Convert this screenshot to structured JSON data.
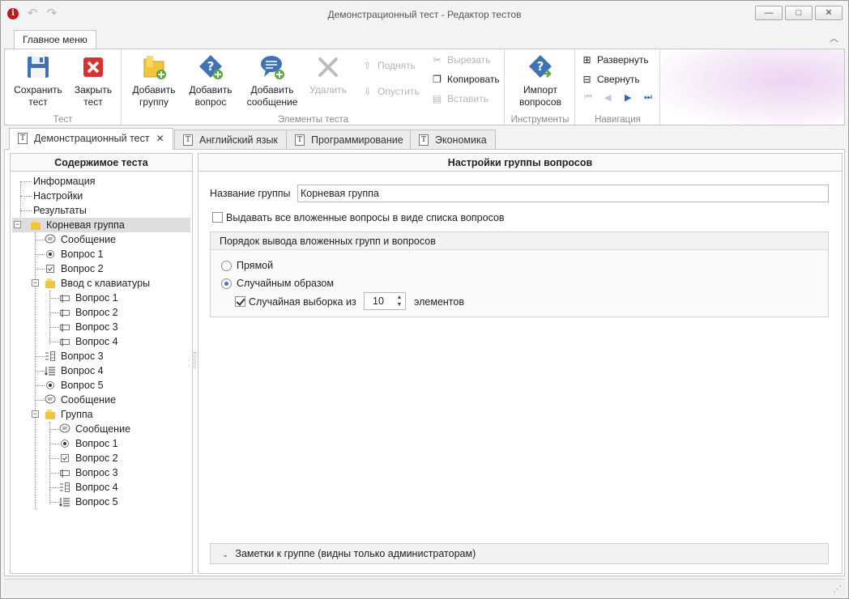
{
  "window": {
    "title": "Демонстрационный тест - Редактор тестов",
    "controls": {
      "minimize": "—",
      "maximize": "□",
      "close": "✕"
    }
  },
  "ribbon": {
    "active_tab": "Главное меню",
    "groups": {
      "test": {
        "label": "Тест",
        "save": "Сохранить\nтест",
        "close": "Закрыть\nтест"
      },
      "elements": {
        "label": "Элементы теста",
        "add_group": "Добавить\nгруппу",
        "add_question": "Добавить\nвопрос",
        "add_message": "Добавить\nсообщение",
        "delete": "Удалить",
        "move_up": "Поднять",
        "move_down": "Опустить",
        "cut": "Вырезать",
        "copy": "Копировать",
        "paste": "Вставить"
      },
      "tools": {
        "label": "Инструменты",
        "import": "Импорт\nвопросов"
      },
      "navigation": {
        "label": "Навигация",
        "expand": "Развернуть",
        "collapse": "Свернуть"
      }
    }
  },
  "doc_tabs": [
    {
      "label": "Демонстрационный тест",
      "active": true
    },
    {
      "label": "Английский язык",
      "active": false
    },
    {
      "label": "Программирование",
      "active": false
    },
    {
      "label": "Экономика",
      "active": false
    }
  ],
  "left_panel": {
    "title": "Содержимое теста",
    "tree": [
      "Информация",
      "Настройки",
      "Результаты",
      "Корневая группа",
      "Сообщение",
      "Вопрос 1",
      "Вопрос 2",
      "Ввод с клавиатуры",
      "Вопрос 1",
      "Вопрос 2",
      "Вопрос 3",
      "Вопрос 4",
      "Вопрос 3",
      "Вопрос 4",
      "Вопрос 5",
      "Сообщение",
      "Группа",
      "Сообщение",
      "Вопрос 1",
      "Вопрос 2",
      "Вопрос 3",
      "Вопрос 4",
      "Вопрос 5"
    ]
  },
  "right_panel": {
    "title": "Настройки группы вопросов",
    "group_name_label": "Название группы",
    "group_name_value": "Корневая группа",
    "list_checkbox_label": "Выдавать все вложенные вопросы в виде списка вопросов",
    "list_checkbox_checked": false,
    "order_box": {
      "title": "Порядок вывода вложенных групп и вопросов",
      "direct_label": "Прямой",
      "random_label": "Случайным образом",
      "selected": "random",
      "sample_label": "Случайная выборка из",
      "sample_checked": true,
      "sample_value": "10",
      "sample_suffix": "элементов"
    },
    "notes_label": "Заметки к группе (видны только администраторам)"
  },
  "colors": {
    "accent": "#3a78c9",
    "danger": "#d8322f",
    "folder": "#f2c53d"
  }
}
